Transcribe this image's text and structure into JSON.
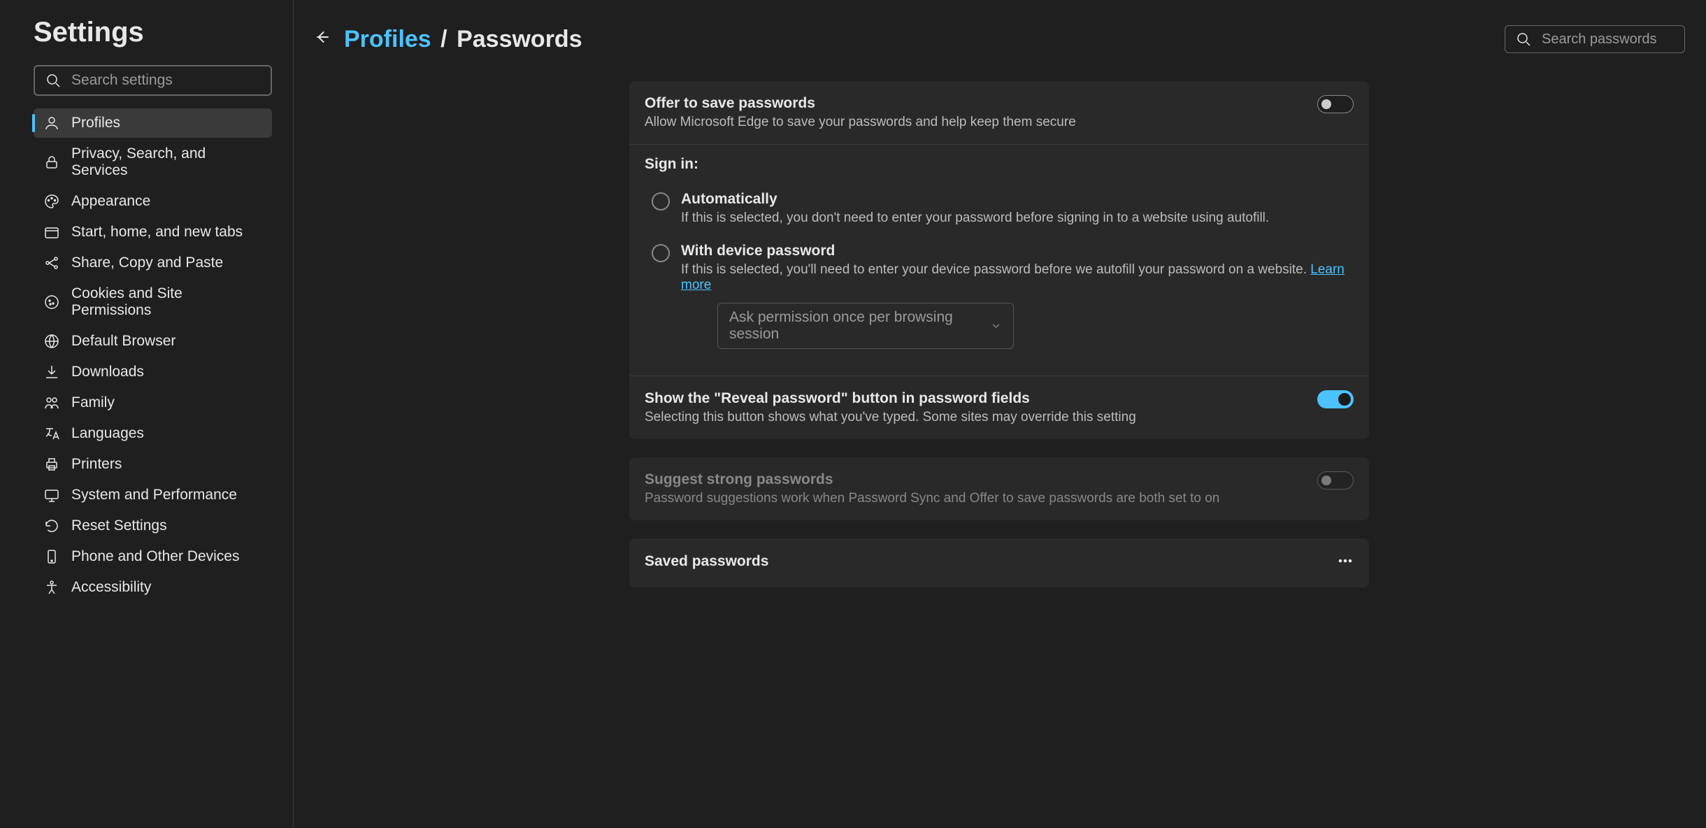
{
  "app_title": "Settings",
  "search_placeholder": "Search settings",
  "nav": [
    {
      "name": "profiles",
      "label": "Profiles",
      "active": true
    },
    {
      "name": "privacy",
      "label": "Privacy, Search, and Services"
    },
    {
      "name": "appearance",
      "label": "Appearance"
    },
    {
      "name": "start",
      "label": "Start, home, and new tabs"
    },
    {
      "name": "share",
      "label": "Share, Copy and Paste"
    },
    {
      "name": "cookies",
      "label": "Cookies and Site Permissions"
    },
    {
      "name": "browser",
      "label": "Default Browser"
    },
    {
      "name": "downloads",
      "label": "Downloads"
    },
    {
      "name": "family",
      "label": "Family"
    },
    {
      "name": "languages",
      "label": "Languages"
    },
    {
      "name": "printers",
      "label": "Printers"
    },
    {
      "name": "system",
      "label": "System and Performance"
    },
    {
      "name": "reset",
      "label": "Reset Settings"
    },
    {
      "name": "phone",
      "label": "Phone and Other Devices"
    },
    {
      "name": "accessibility",
      "label": "Accessibility"
    }
  ],
  "breadcrumb": {
    "link": "Profiles",
    "sep": "/",
    "current": "Passwords"
  },
  "search_passwords_placeholder": "Search passwords",
  "offer": {
    "title": "Offer to save passwords",
    "desc": "Allow Microsoft Edge to save your passwords and help keep them secure",
    "state": "off"
  },
  "signin": {
    "heading": "Sign in:",
    "auto": {
      "label": "Automatically",
      "desc": "If this is selected, you don't need to enter your password before signing in to a website using autofill."
    },
    "device": {
      "label": "With device password",
      "desc": "If this is selected, you'll need to enter your device password before we autofill your password on a website. ",
      "learn": "Learn more"
    },
    "dropdown": "Ask permission once per browsing session"
  },
  "reveal": {
    "title": "Show the \"Reveal password\" button in password fields",
    "desc": "Selecting this button shows what you've typed. Some sites may override this setting",
    "state": "on"
  },
  "suggest": {
    "title": "Suggest strong passwords",
    "desc": "Password suggestions work when Password Sync and Offer to save passwords are both set to on",
    "state": "off"
  },
  "saved": {
    "title": "Saved passwords"
  }
}
